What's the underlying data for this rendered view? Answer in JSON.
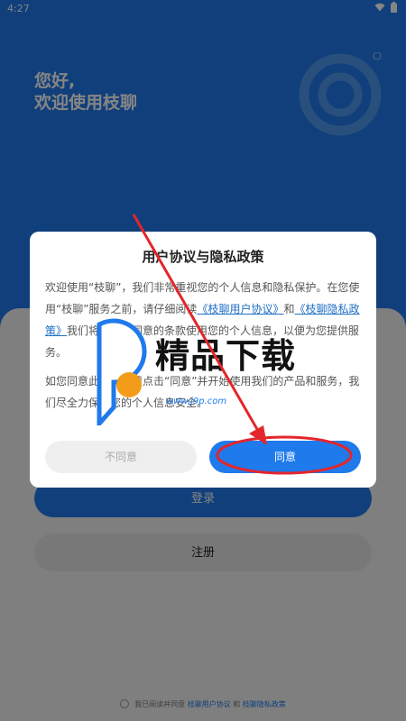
{
  "status_bar": {
    "time": "4:27"
  },
  "greeting": {
    "line1": "您好,",
    "line2": "欢迎使用枝聊"
  },
  "login": {
    "label": "登录"
  },
  "register": {
    "label": "注册"
  },
  "bottom_consent": {
    "prefix": "我已阅读并同意",
    "user_agreement": "枝聊用户协议",
    "and": "和",
    "privacy_policy": "枝聊隐私政策"
  },
  "dialog": {
    "title": "用户协议与隐私政策",
    "para1": "欢迎使用“枝聊”，我们非常重视您的个人信息和隐私保护。在您使用“枝聊”服务之前，请仔细阅读",
    "link_user_agreement": "《枝聊用户协议》",
    "and": "和",
    "link_privacy_policy": "《枝聊隐私政策》",
    "para1_tail": "我们将按照您同意的条款使用您的个人信息，以便为您提供服务。",
    "para2": "如您同意此政策，请点击“同意”并开始使用我们的产品和服务，我们尽全力保护您的个人信息安全。",
    "disagree_label": "不同意",
    "agree_label": "同意"
  },
  "watermark": {
    "text": "精品下载",
    "url": "www.j9p.com"
  },
  "colors": {
    "brand": "#1f7aec",
    "annotation": "#e3262b"
  }
}
